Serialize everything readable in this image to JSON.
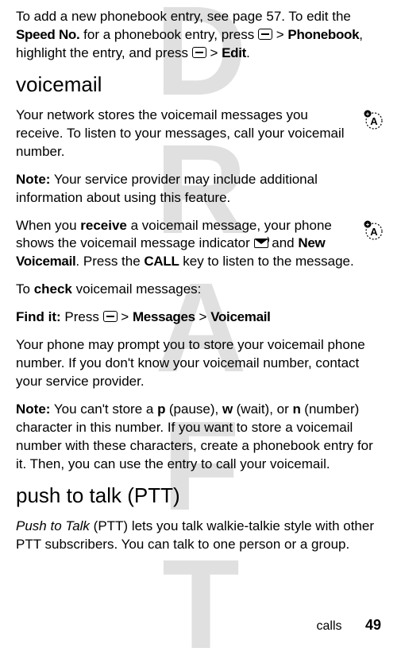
{
  "watermark": "DRAFT",
  "intro": {
    "p1a": "To add a new phonebook entry, see page 57. To edit the ",
    "speedno": "Speed No.",
    "p1b": " for a phonebook entry, press ",
    "gt1": " > ",
    "phonebook": "Phonebook",
    "p1c": ", highlight the entry, and press ",
    "gt2": " > ",
    "edit": "Edit",
    "p1d": "."
  },
  "voicemail": {
    "heading": "voicemail",
    "p1": "Your network stores the voicemail messages you receive. To listen to your messages, call your voicemail number.",
    "note1a": "Note:",
    "note1b": " Your service provider may include additional information about using this feature.",
    "p2a": "When you ",
    "receive": "receive",
    "p2b": " a voicemail message, your phone shows the voicemail message indicator ",
    "p2c": " and ",
    "newvm": "New Voicemail",
    "p2d": ". Press the ",
    "call": "CALL",
    "p2e": " key to listen to the message.",
    "p3a": "To ",
    "check": "check",
    "p3b": " voicemail messages:",
    "findit": "Find it:",
    "finditb": " Press ",
    "gt1": " > ",
    "messages": "Messages",
    "gt2": " > ",
    "vmlabel": "Voicemail",
    "p4": "Your phone may prompt you to store your voicemail phone number. If you don't know your voicemail number, contact your service provider.",
    "note2a": "Note:",
    "note2b": " You can't store a ",
    "p_char": "p",
    "note2c": " (pause), ",
    "w_char": "w",
    "note2d": " (wait), or ",
    "n_char": "n",
    "note2e": " (number) character in this number. If you want to store a voicemail number with these characters, create a phonebook entry for it. Then, you can use the entry to call your voicemail."
  },
  "ptt": {
    "heading": "push to talk (PTT)",
    "p1a": "Push to Talk",
    "p1b": "  (PTT) lets you talk walkie-talkie style with other PTT subscribers. You can talk to one person or a group."
  },
  "footer": {
    "section": "calls",
    "page": "49"
  }
}
